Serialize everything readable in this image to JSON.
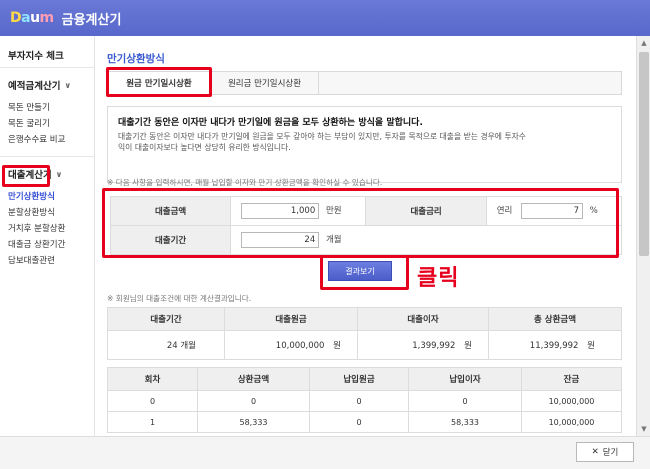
{
  "app": {
    "logo_letters": [
      "D",
      "a",
      "u",
      "m"
    ],
    "title": "금융계산기"
  },
  "sidebar": {
    "top_item": "부자지수 체크",
    "deposit_section": {
      "heading": "예적금계산기",
      "items": [
        "목돈 만들기",
        "목돈 굴리기",
        "은행수수료 비교"
      ]
    },
    "loan_section": {
      "heading": "대출계산기",
      "items": [
        "만기상환방식",
        "분할상환방식",
        "거치후 분할상환",
        "대출금 상환기간",
        "담보대출관련"
      ],
      "active_index": 0
    }
  },
  "main": {
    "section_title": "만기상환방식",
    "tabs": [
      "원금 만기일시상환",
      "원리금 만기일시상환"
    ],
    "active_tab": 0,
    "description": {
      "title": "대출기간 동안은 이자만 내다가 만기일에 원금을 모두 상환하는 방식을 말합니다.",
      "body_line1": "대출기간 동안은 이자만 내다가 만기일에 원금을 모두 갚아야 하는 부담이 있지만, 투자를 목적으로 대출을 받는 경우에 투자수",
      "body_line2": "익이 대출이자보다 높다면 상당히 유리한 방식입니다."
    },
    "input_note": "※ 다음 사항을 입력하시면, 매월 납입할 이자와 만기 상환금액을 확인하실 수 있습니다.",
    "inputs": {
      "loan_amount_label": "대출금액",
      "loan_amount_value": "1,000",
      "loan_amount_unit": "만원",
      "interest_rate_label": "대출금리",
      "interest_rate_prefix": "연리",
      "interest_rate_value": "7",
      "interest_rate_unit": "%",
      "loan_period_label": "대출기간",
      "loan_period_value": "24",
      "loan_period_unit": "개월"
    },
    "result_button": "결과보기",
    "click_label": "클릭",
    "result_note": "※ 회원님의 대출조건에 대한 계산결과입니다.",
    "summary": {
      "headers": [
        "대출기간",
        "대출원금",
        "대출이자",
        "총 상환금액"
      ],
      "row": [
        {
          "value": "24",
          "unit": "개월"
        },
        {
          "value": "10,000,000",
          "unit": "원"
        },
        {
          "value": "1,399,992",
          "unit": "원"
        },
        {
          "value": "11,399,992",
          "unit": "원"
        }
      ]
    },
    "detail": {
      "headers": [
        "회차",
        "상환금액",
        "납입원금",
        "납입이자",
        "잔금"
      ],
      "rows": [
        [
          "0",
          "0",
          "0",
          "0",
          "10,000,000"
        ],
        [
          "1",
          "58,333",
          "0",
          "58,333",
          "10,000,000"
        ]
      ]
    }
  },
  "footer": {
    "close_label": "닫기"
  }
}
